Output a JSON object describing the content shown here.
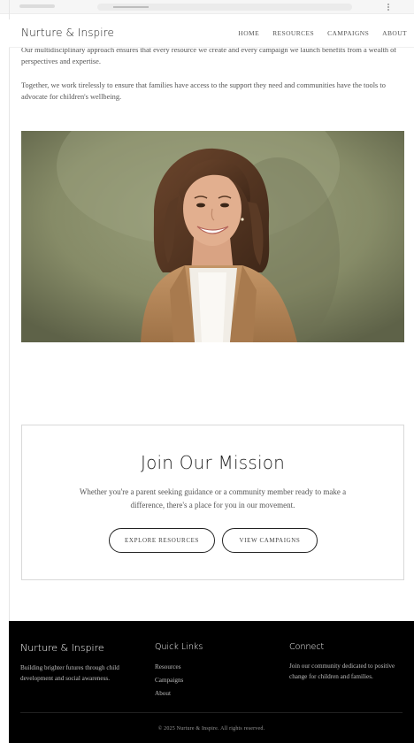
{
  "header": {
    "brand": "Nurture & Inspire",
    "nav": [
      "HOME",
      "RESOURCES",
      "CAMPAIGNS",
      "ABOUT"
    ]
  },
  "content": {
    "paragraph_1": "Our multidisciplinary approach ensures that every resource we create and every campaign we launch benefits from a wealth of perspectives and expertise.",
    "paragraph_2": "Together, we work tirelessly to ensure that families have access to the support they need and communities have the tools to advocate for children's wellbeing."
  },
  "mission": {
    "title": "Join Our Mission",
    "text": "Whether you're a parent seeking guidance or a community member ready to make a difference, there's a place for you in our movement.",
    "button_resources": "EXPLORE RESOURCES",
    "button_campaigns": "VIEW CAMPAIGNS"
  },
  "footer": {
    "brand": "Nurture & Inspire",
    "brand_text": "Building brighter futures through child development and social awareness.",
    "quick_links_title": "Quick Links",
    "quick_links": [
      "Resources",
      "Campaigns",
      "About"
    ],
    "connect_title": "Connect",
    "connect_text": "Join our community dedicated to positive change for children and families.",
    "copyright": "© 2025 Nurture & Inspire. All rights reserved."
  },
  "colors": {
    "footer_bg": "#000000",
    "photo_backdrop": "#8c9170",
    "jacket": "#b88a5c"
  },
  "icons": {
    "hero_image": "portrait-photo-woman-smiling"
  }
}
